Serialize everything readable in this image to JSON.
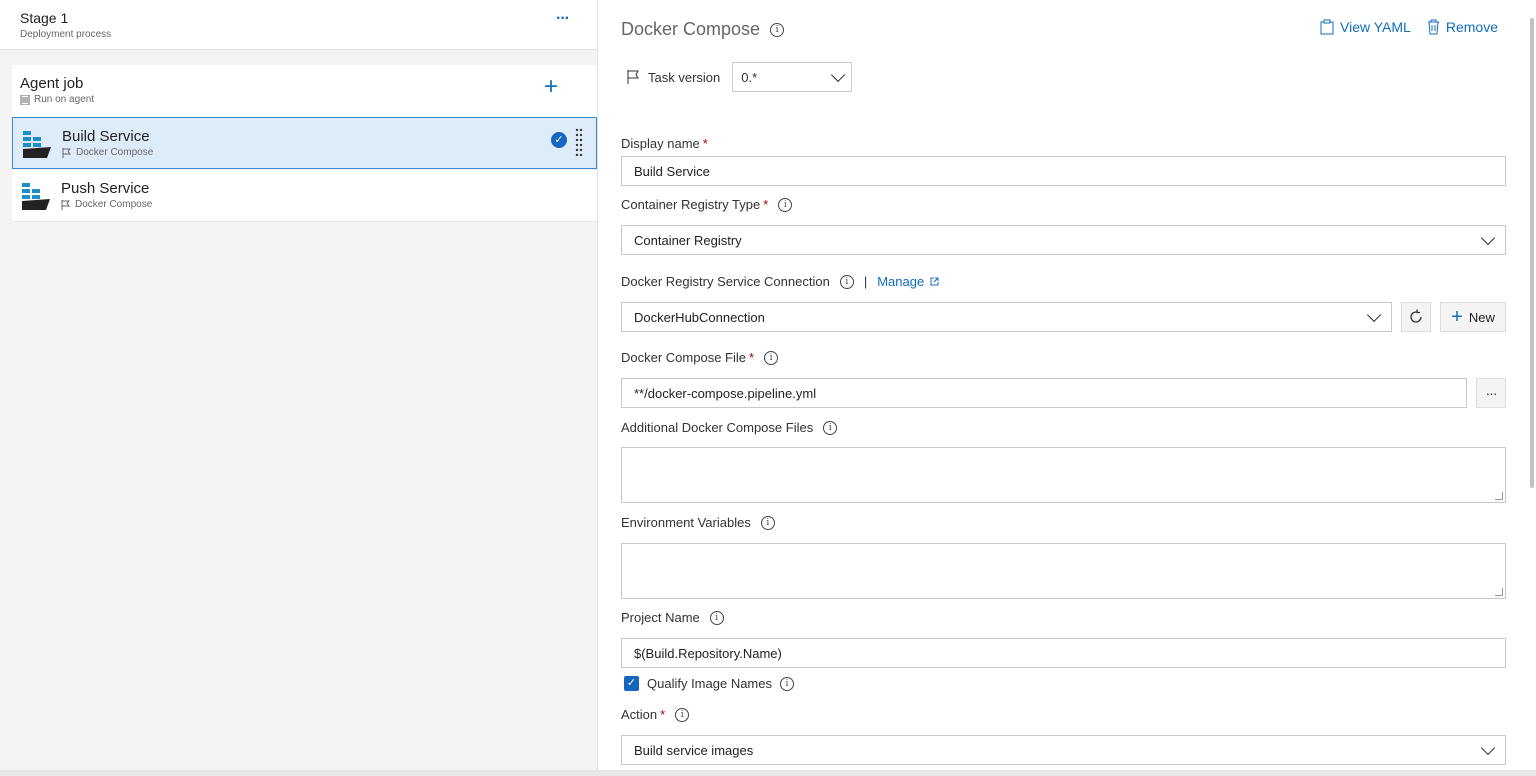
{
  "colors": {
    "accent": "#106ebe",
    "selected_bg": "#deecf9",
    "required": "#a80000"
  },
  "stage": {
    "title": "Stage 1",
    "subtitle": "Deployment process",
    "more_label": "···"
  },
  "agent_job": {
    "title": "Agent job",
    "subtitle": "Run on agent",
    "add_label": "+"
  },
  "tasks": [
    {
      "name": "Build Service",
      "subtitle": "Docker Compose",
      "selected": true
    },
    {
      "name": "Push Service",
      "subtitle": "Docker Compose",
      "selected": false
    }
  ],
  "detail": {
    "title": "Docker Compose",
    "view_yaml_label": "View YAML",
    "remove_label": "Remove",
    "task_version_label": "Task version",
    "task_version_value": "0.*",
    "display_name": {
      "label": "Display name",
      "required": "*",
      "value": "Build Service"
    },
    "registry_type": {
      "label": "Container Registry Type",
      "required": "*",
      "value": "Container Registry"
    },
    "service_connection": {
      "label": "Docker Registry Service Connection",
      "separator": "|",
      "manage_label": "Manage",
      "value": "DockerHubConnection",
      "new_label": "New"
    },
    "compose_file": {
      "label": "Docker Compose File",
      "required": "*",
      "value": "**/docker-compose.pipeline.yml",
      "browse_label": "···"
    },
    "additional_files": {
      "label": "Additional Docker Compose Files",
      "value": ""
    },
    "env_vars": {
      "label": "Environment Variables",
      "value": ""
    },
    "project_name": {
      "label": "Project Name",
      "value": "$(Build.Repository.Name)"
    },
    "qualify_names": {
      "label": "Qualify Image Names",
      "checked": true
    },
    "action": {
      "label": "Action",
      "required": "*",
      "value": "Build service images"
    }
  }
}
